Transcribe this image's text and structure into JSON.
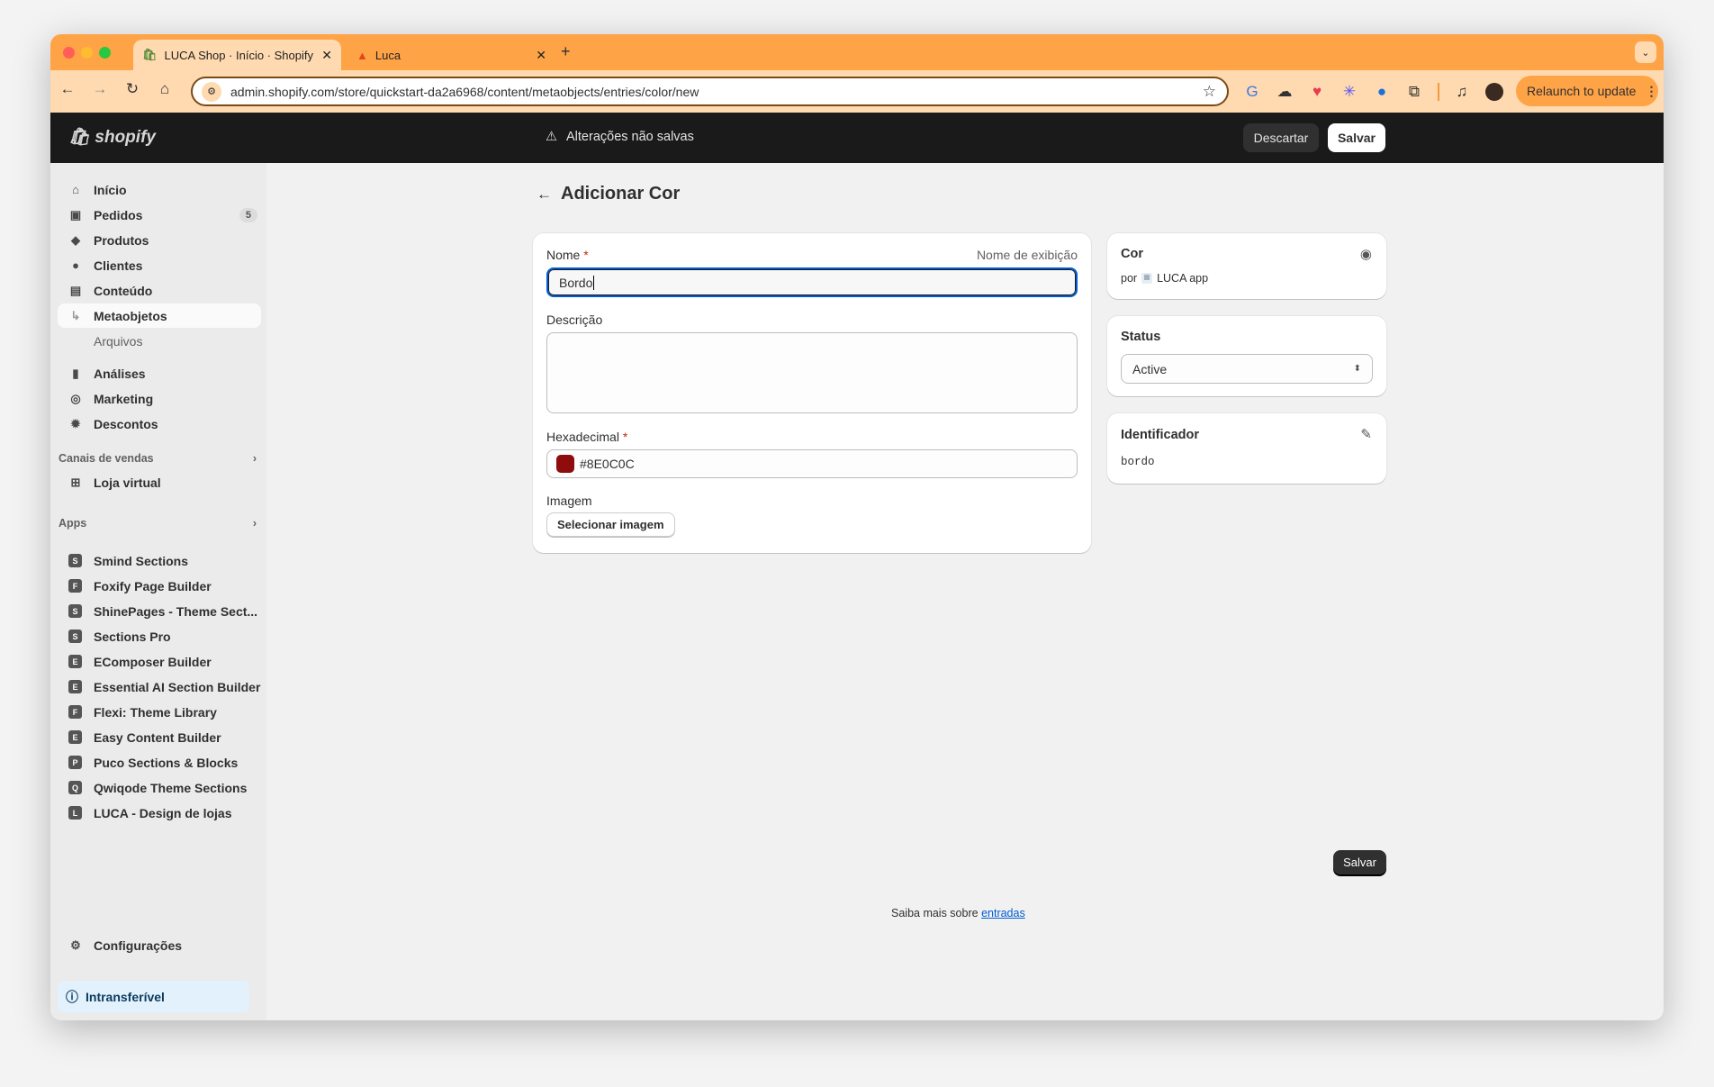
{
  "browser": {
    "tabs": [
      {
        "title": "LUCA Shop · Início · Shopify",
        "active": true
      },
      {
        "title": "Luca",
        "active": false
      }
    ],
    "url": "admin.shopify.com/store/quickstart-da2a6968/content/metaobjects/entries/color/new",
    "relaunch_label": "Relaunch to update",
    "extension_icons": [
      "google-translate-icon",
      "cloud-icon",
      "pocket-icon",
      "snowflake-icon",
      "firefox-icon",
      "puzzle-icon",
      "media-icon",
      "avatar"
    ]
  },
  "header": {
    "logo": "shopify",
    "unsaved": "Alterações não salvas",
    "discard": "Descartar",
    "save": "Salvar"
  },
  "sidebar": {
    "items": [
      {
        "label": "Início",
        "icon": "home-icon"
      },
      {
        "label": "Pedidos",
        "icon": "inbox-icon",
        "badge": "5"
      },
      {
        "label": "Produtos",
        "icon": "tag-icon"
      },
      {
        "label": "Clientes",
        "icon": "person-icon"
      },
      {
        "label": "Conteúdo",
        "icon": "image-icon"
      },
      {
        "label": "Metaobjetos",
        "selected": true
      },
      {
        "label": "Arquivos"
      },
      {
        "label": "Análises",
        "icon": "bar-chart-icon"
      },
      {
        "label": "Marketing",
        "icon": "target-icon"
      },
      {
        "label": "Descontos",
        "icon": "discount-icon"
      }
    ],
    "sales_channels_label": "Canais de vendas",
    "sales_channels": [
      {
        "label": "Loja virtual"
      }
    ],
    "apps_label": "Apps",
    "apps": [
      "Smind Sections",
      "Foxify Page Builder",
      "ShinePages - Theme Sect...",
      "Sections Pro",
      "EComposer Builder",
      "Essential AI Section Builder",
      "Flexi: Theme Library",
      "Easy Content Builder",
      "Puco Sections & Blocks",
      "Qwiqode Theme Sections",
      "LUCA - Design de lojas"
    ],
    "settings": "Configurações",
    "notice": "Intransferível"
  },
  "main": {
    "title": "Adicionar Cor",
    "name_label": "Nome",
    "name_hint": "Nome de exibição",
    "name_value": "Bordo",
    "description_label": "Descrição",
    "description_value": "",
    "hex_label": "Hexadecimal",
    "hex_value": "#8E0C0C",
    "swatch_color": "#8e0c0c",
    "image_label": "Imagem",
    "select_image": "Selecionar imagem",
    "required_mark": "*",
    "save": "Salvar",
    "learn_more": "Saiba mais sobre",
    "learn_more_link": "entradas"
  },
  "side": {
    "definition_title": "Cor",
    "by": "por",
    "app": "LUCA app",
    "status_title": "Status",
    "status_value": "Active",
    "handle_title": "Identificador",
    "handle_value": "bordo"
  }
}
